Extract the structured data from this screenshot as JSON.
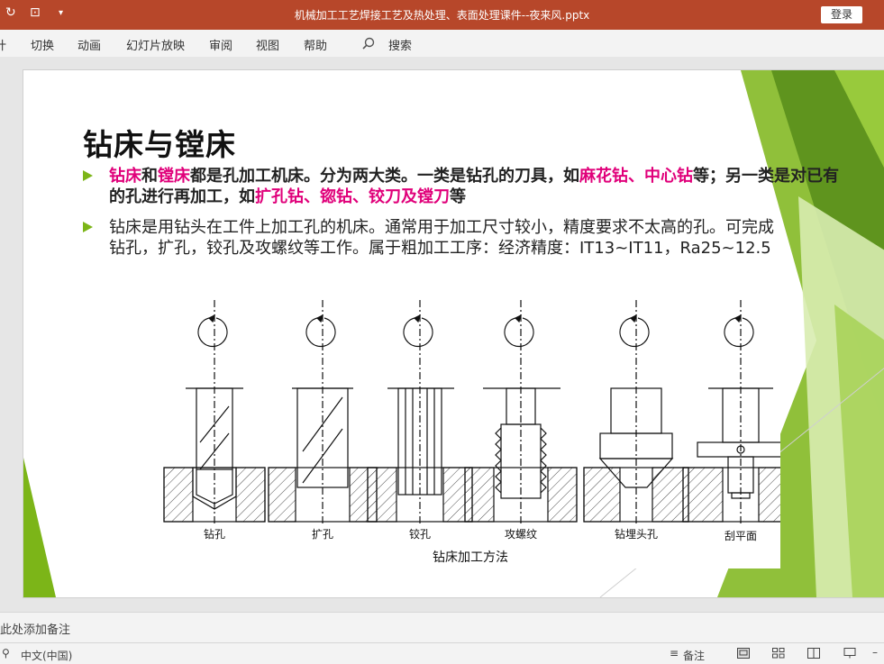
{
  "titlebar": {
    "document_title": "机械加工工艺焊接工艺及热处理、表面处理课件--夜来风.pptx",
    "login_label": "登录"
  },
  "ribbon": {
    "tabs": [
      "切换",
      "动画",
      "幻灯片放映",
      "审阅",
      "视图",
      "帮助"
    ],
    "search_label": "搜索"
  },
  "slide": {
    "title": "钻床与镗床",
    "bullet1": {
      "line1_parts": [
        "钻床",
        "和",
        "镗床",
        "都是孔加工机床。分为两大类。一类是钻孔的刀具，如",
        "麻花钻",
        "、",
        "中心钻",
        "等；另一类是对已有"
      ],
      "line2_parts": [
        "的孔进行再加工，如",
        "扩孔钻、锪钻、铰刀及镗刀",
        "等"
      ]
    },
    "bullet2": {
      "line1": "钻床是用钻头在工件上加工孔的机床。通常用于加工尺寸较小，精度要求不太高的孔。可完成",
      "line2": "钻孔，扩孔，铰孔及攻螺纹等工作。属于粗加工工序：经济精度：IT13~IT11，Ra25~12.5"
    },
    "figure": {
      "labels": [
        "钻孔",
        "扩孔",
        "铰孔",
        "攻螺纹",
        "钻埋头孔",
        "刮平面"
      ],
      "caption": "钻床加工方法"
    }
  },
  "notes_bar": {
    "label": "单击此处添加备注"
  },
  "status_bar": {
    "language": "中文(中国)",
    "notes_label": "备注"
  },
  "colors": {
    "title_bar": "#b7472a",
    "accent_green": "#7cb518",
    "highlight_magenta": "#e0007a"
  }
}
